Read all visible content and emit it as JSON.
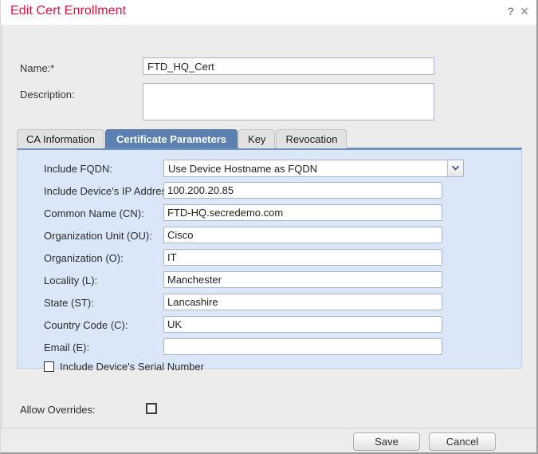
{
  "window": {
    "title": "Edit Cert Enrollment",
    "help_icon": "question-mark-icon",
    "close_icon": "close-icon",
    "title_color": "#e2103c"
  },
  "header_fields": {
    "name_label": "Name:*",
    "name_value": "FTD_HQ_Cert",
    "description_label": "Description:",
    "description_value": ""
  },
  "tabs": [
    {
      "label": "CA Information",
      "active": false
    },
    {
      "label": "Certificate Parameters",
      "active": true
    },
    {
      "label": "Key",
      "active": false
    },
    {
      "label": "Revocation",
      "active": false
    }
  ],
  "certificate_parameters": {
    "fqdn": {
      "label": "Include FQDN:",
      "selected": "Use Device Hostname as FQDN",
      "arrow_icon": "chevron-down-icon"
    },
    "fields": [
      {
        "label": "Include Device's IP Address:",
        "value": "100.200.20.85"
      },
      {
        "label": "Common Name (CN):",
        "value": "FTD-HQ.secredemo.com"
      },
      {
        "label": "Organization Unit (OU):",
        "value": "Cisco"
      },
      {
        "label": "Organization (O):",
        "value": "IT"
      },
      {
        "label": "Locality (L):",
        "value": "Manchester"
      },
      {
        "label": "State (ST):",
        "value": "Lancashire"
      },
      {
        "label": "Country Code (C):",
        "value": "UK"
      },
      {
        "label": "Email (E):",
        "value": ""
      }
    ],
    "serial_number": {
      "label": "Include Device's Serial Number",
      "checked": false
    }
  },
  "allow_overrides": {
    "label": "Allow Overrides:",
    "checked": false
  },
  "footer": {
    "save_label": "Save",
    "cancel_label": "Cancel"
  },
  "colors": {
    "accent_red": "#e2103c",
    "active_tab_blue": "#5c80b1",
    "panel_blue": "#d9e7f8",
    "panel_top_border": "#6f92bf"
  }
}
